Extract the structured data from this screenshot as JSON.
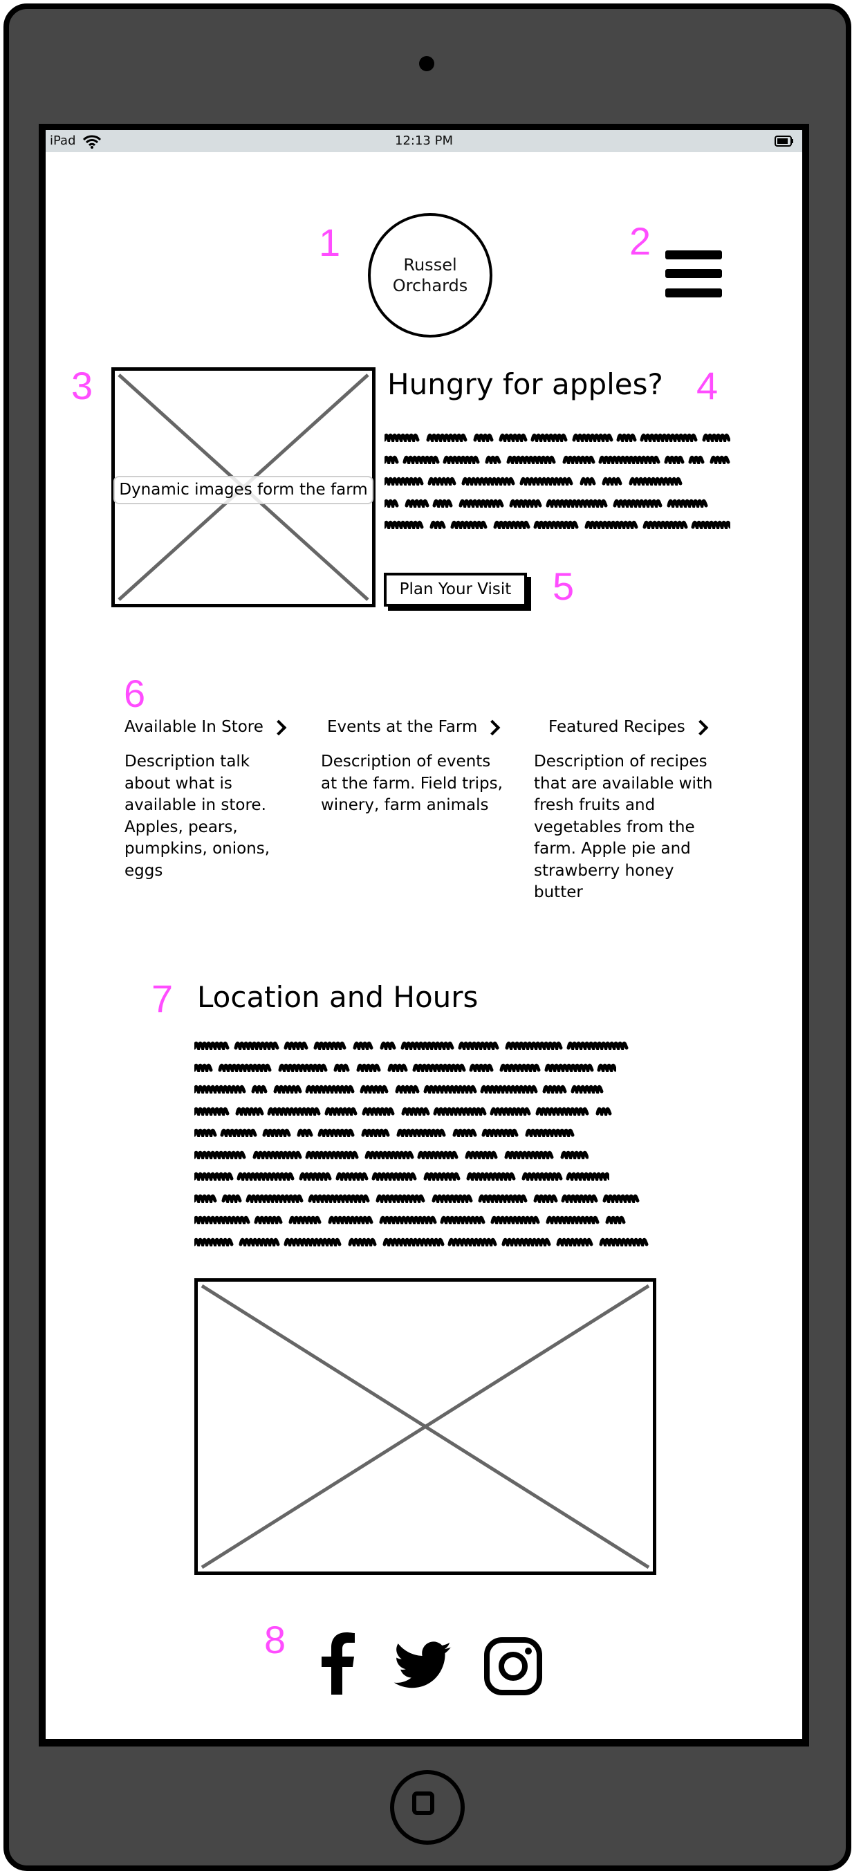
{
  "device": {
    "model": "iPad",
    "status_bar": {
      "carrier": "iPad",
      "time": "12:13 PM",
      "wifi_icon": "wifi-icon",
      "battery_icon": "battery-icon"
    }
  },
  "annotations": [
    "1",
    "2",
    "3",
    "4",
    "5",
    "6",
    "7",
    "8"
  ],
  "colors": {
    "annotation": "#ff4dff",
    "bezel": "#474747",
    "status_bar": "#d7dde0",
    "placeholder_x": "#666666"
  },
  "header": {
    "logo_line1": "Russel",
    "logo_line2": "Orchards",
    "menu_icon": "hamburger-menu-icon"
  },
  "hero": {
    "image_caption": "Dynamic images form the farm",
    "title": "Hungry for apples?",
    "placeholder_text_lines": 5,
    "cta_label": "Plan Your Visit"
  },
  "features": [
    {
      "title": "Available In Store",
      "description": "Description talk about what is available in store. Apples, pears, pumpkins, onions, eggs"
    },
    {
      "title": "Events at the Farm",
      "description": "Description of events at the farm. Field trips, winery, farm animals"
    },
    {
      "title": "Featured Recipes",
      "description": "Description of recipes that are available with fresh fruits and vegetables from the farm. Apple pie and strawberry honey butter"
    }
  ],
  "location": {
    "title": "Location and Hours",
    "placeholder_text_lines": 10,
    "map_icon": "image-placeholder-icon"
  },
  "social": [
    {
      "name": "Facebook",
      "icon": "facebook-icon"
    },
    {
      "name": "Twitter",
      "icon": "twitter-icon"
    },
    {
      "name": "Instagram",
      "icon": "instagram-icon"
    }
  ]
}
